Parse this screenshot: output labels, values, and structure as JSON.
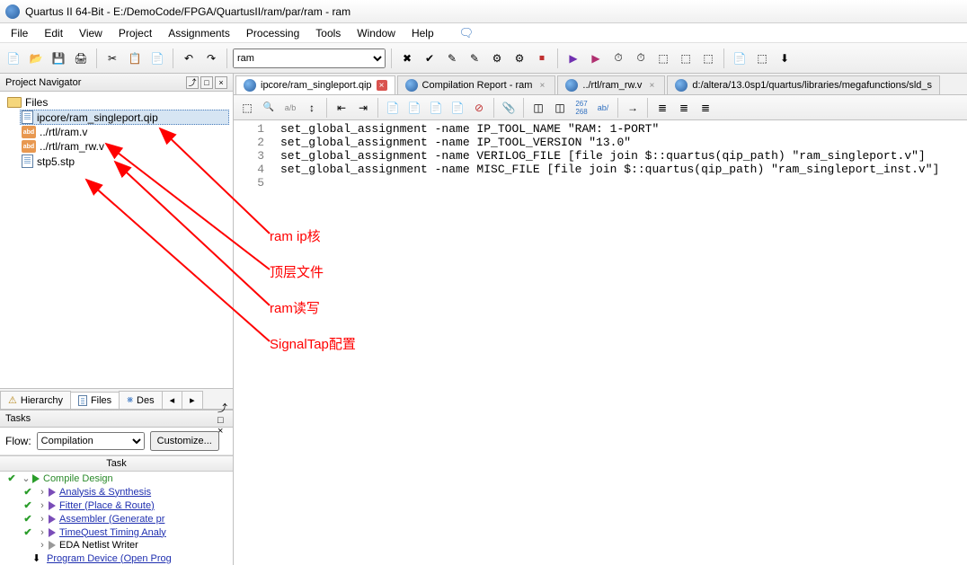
{
  "title": "Quartus II 64-Bit - E:/DemoCode/FPGA/QuartusII/ram/par/ram - ram",
  "menu": [
    "File",
    "Edit",
    "View",
    "Project",
    "Assignments",
    "Processing",
    "Tools",
    "Window",
    "Help"
  ],
  "top_combo": "ram",
  "nav": {
    "title": "Project Navigator",
    "root": "Files",
    "files": [
      "ipcore/ram_singleport.qip",
      "../rtl/ram.v",
      "../rtl/ram_rw.v",
      "stp5.stp"
    ],
    "tabs": [
      "Hierarchy",
      "Files",
      "Des"
    ]
  },
  "tasks": {
    "title": "Tasks",
    "flow_label": "Flow:",
    "flow_value": "Compilation",
    "customize": "Customize...",
    "col": "Task",
    "items": [
      {
        "check": true,
        "exp": "⌄",
        "play": "green",
        "name": "Compile Design",
        "link": false,
        "indent": 0
      },
      {
        "check": true,
        "exp": ">",
        "play": "purple",
        "name": "Analysis & Synthesis",
        "link": true,
        "indent": 1
      },
      {
        "check": true,
        "exp": ">",
        "play": "purple",
        "name": "Fitter (Place & Route)",
        "link": true,
        "indent": 1
      },
      {
        "check": true,
        "exp": ">",
        "play": "purple",
        "name": "Assembler (Generate pr",
        "link": true,
        "indent": 1
      },
      {
        "check": true,
        "exp": ">",
        "play": "purple",
        "name": "TimeQuest Timing Analy",
        "link": true,
        "indent": 1
      },
      {
        "check": false,
        "exp": ">",
        "play": "gray",
        "name": "EDA Netlist Writer",
        "link": false,
        "indent": 1
      },
      {
        "check": false,
        "exp": "",
        "play": "",
        "name": "Program Device (Open Prog",
        "link": true,
        "indent": 1,
        "device": true
      }
    ]
  },
  "editor": {
    "tabs": [
      {
        "label": "ipcore/ram_singleport.qip",
        "active": true,
        "closeon": true
      },
      {
        "label": "Compilation Report - ram",
        "active": false,
        "closeon": false
      },
      {
        "label": "../rtl/ram_rw.v",
        "active": false,
        "closeon": false
      },
      {
        "label": "d:/altera/13.0sp1/quartus/libraries/megafunctions/sld_s",
        "active": false,
        "closeon": false
      }
    ],
    "lines": [
      "set_global_assignment -name IP_TOOL_NAME \"RAM: 1-PORT\"",
      "set_global_assignment -name IP_TOOL_VERSION \"13.0\"",
      "set_global_assignment -name VERILOG_FILE [file join $::quartus(qip_path) \"ram_singleport.v\"]",
      "set_global_assignment -name MISC_FILE [file join $::quartus(qip_path) \"ram_singleport_inst.v\"]",
      ""
    ]
  },
  "annotations": {
    "a1": "ram ip核",
    "a2": "顶层文件",
    "a3": "ram读写",
    "a4": "SignalTap配置"
  }
}
